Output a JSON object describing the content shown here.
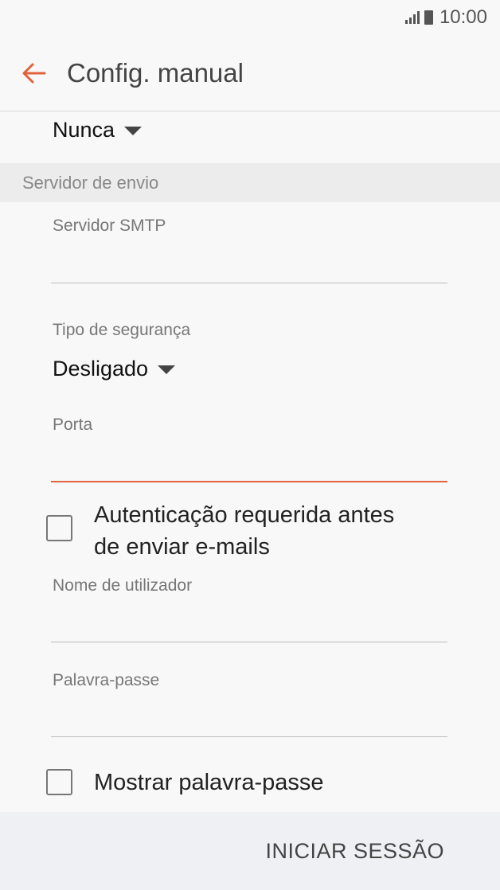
{
  "status_bar": {
    "time": "10:00"
  },
  "app_bar": {
    "title": "Config. manual"
  },
  "sync": {
    "selected": "Nunca"
  },
  "section": {
    "title": "Servidor de envio"
  },
  "smtp": {
    "label": "Servidor SMTP",
    "value": ""
  },
  "security": {
    "label": "Tipo de segurança",
    "selected": "Desligado"
  },
  "port": {
    "label": "Porta",
    "value": ""
  },
  "auth_checkbox": {
    "label_line1": "Autenticação requerida antes",
    "label_line2": "de enviar e-mails",
    "checked": false
  },
  "username": {
    "label": "Nome de utilizador",
    "value": ""
  },
  "password": {
    "label": "Palavra-passe",
    "value": ""
  },
  "show_password": {
    "label": "Mostrar palavra-passe",
    "checked": false
  },
  "bottom": {
    "signin_label": "INICIAR SESSÃO"
  },
  "colors": {
    "accent": "#e0633d",
    "background": "#f8f8f8",
    "section_bg": "#ececec",
    "bottom_bar_bg": "#eef0f3"
  }
}
